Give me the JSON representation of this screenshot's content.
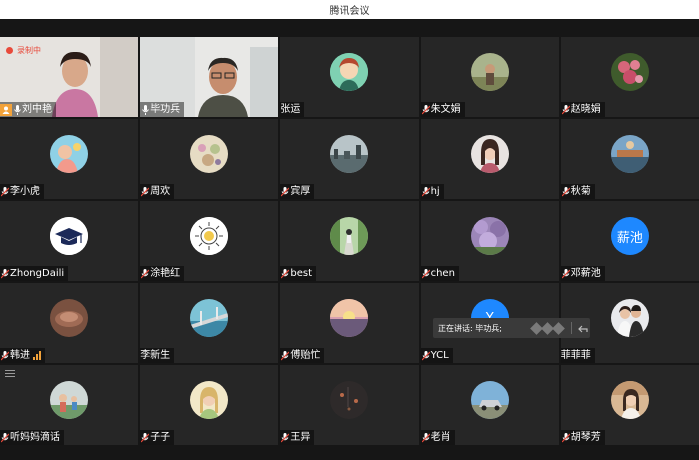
{
  "window": {
    "title": "腾讯会议"
  },
  "recording": {
    "label": "录制中"
  },
  "speaking_popup": {
    "label": "正在讲话: 毕功兵;"
  },
  "colors": {
    "accent": "#2dbd6e",
    "recording": "#e84a3b",
    "host": "#f2a23a",
    "blue_avatar": "#1e88ff"
  },
  "participants": [
    {
      "name": "刘中艳",
      "kind": "video"
    },
    {
      "name": "毕功兵",
      "kind": "video"
    },
    {
      "name": "张运",
      "kind": "avatar"
    },
    {
      "name": "朱文娟",
      "kind": "avatar"
    },
    {
      "name": "赵晓娟",
      "kind": "avatar"
    },
    {
      "name": "李小虎",
      "kind": "avatar"
    },
    {
      "name": "周欢",
      "kind": "avatar"
    },
    {
      "name": "宾厚",
      "kind": "avatar"
    },
    {
      "name": "hj",
      "kind": "avatar"
    },
    {
      "name": "秋菊",
      "kind": "avatar"
    },
    {
      "name": "ZhongDaili",
      "kind": "avatar"
    },
    {
      "name": "涂艳红",
      "kind": "avatar"
    },
    {
      "name": "best",
      "kind": "avatar"
    },
    {
      "name": "chen",
      "kind": "avatar"
    },
    {
      "name": "邓薪池",
      "kind": "avatar",
      "avatar_text": "薪池"
    },
    {
      "name": "韩进",
      "kind": "avatar"
    },
    {
      "name": "李新生",
      "kind": "avatar"
    },
    {
      "name": "傅贻忙",
      "kind": "avatar"
    },
    {
      "name": "YCL",
      "kind": "avatar",
      "avatar_text": "Y"
    },
    {
      "name": "菲菲菲",
      "kind": "avatar"
    },
    {
      "name": "听妈妈滴话",
      "kind": "avatar"
    },
    {
      "name": "子子",
      "kind": "avatar"
    },
    {
      "name": "王异",
      "kind": "avatar"
    },
    {
      "name": "老肖",
      "kind": "avatar"
    },
    {
      "name": "胡琴芳",
      "kind": "avatar"
    }
  ]
}
